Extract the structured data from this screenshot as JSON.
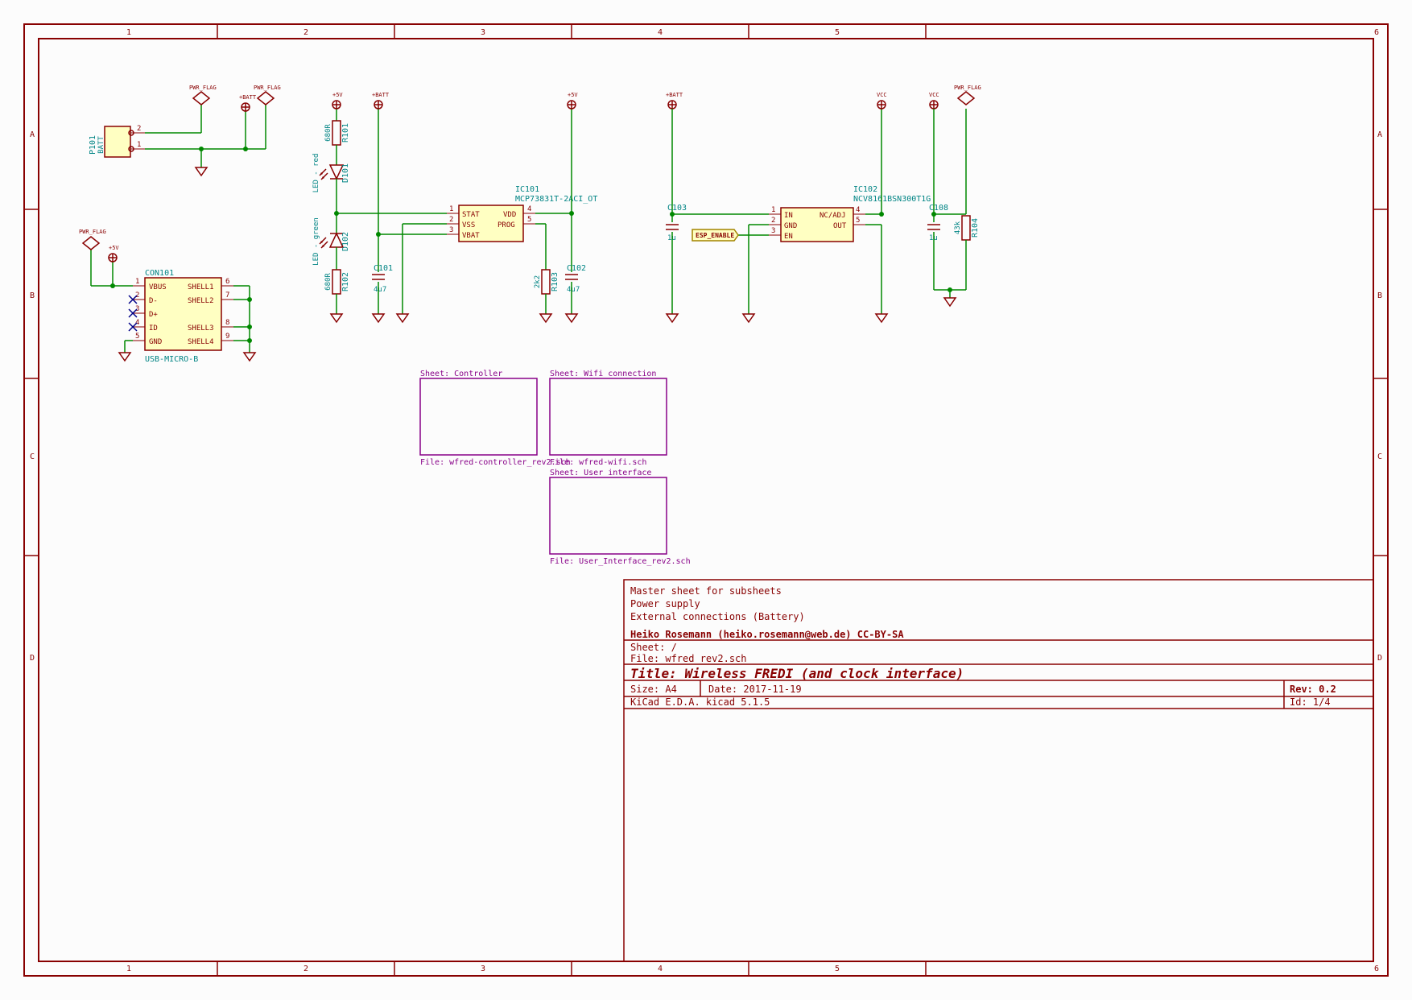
{
  "title_block": {
    "comment1": "Master sheet for subsheets",
    "comment2": "Power supply",
    "comment3": "External connections (Battery)",
    "author": "Heiko Rosemann (heiko.rosemann@web.de) CC-BY-SA",
    "sheet_label": "Sheet:",
    "sheet_path": "/",
    "file_label": "File:",
    "file_name": "wfred_rev2.sch",
    "title_label": "Title:",
    "title": "Wireless FREDI (and clock interface)",
    "size_label": "Size:",
    "size": "A4",
    "date_label": "Date:",
    "date": "2017-11-19",
    "rev_label": "Rev:",
    "rev": "0.2",
    "tool": "KiCad E.D.A.  kicad 5.1.5",
    "id_label": "Id:",
    "id": "1/4"
  },
  "power_flags": {
    "pf": "PWR_FLAG"
  },
  "nets": {
    "vbatt": "+BATT",
    "v5": "+5V",
    "vcc": "VCC"
  },
  "conn_batt": {
    "ref": "P101",
    "val": "BATT",
    "pin1": "1",
    "pin2": "2"
  },
  "conn_usb": {
    "ref": "CON101",
    "val": "USB-MICRO-B",
    "p1": "VBUS",
    "p2": "D-",
    "p3": "D+",
    "p4": "ID",
    "p5": "GND",
    "p6": "SHELL1",
    "p7": "SHELL2",
    "p8": "SHELL3",
    "p9": "SHELL4",
    "n1": "1",
    "n2": "2",
    "n3": "3",
    "n4": "4",
    "n5": "5",
    "n6": "6",
    "n7": "7",
    "n8": "8",
    "n9": "9"
  },
  "r101": {
    "ref": "R101",
    "val": "680R"
  },
  "r102": {
    "ref": "R102",
    "val": "680R"
  },
  "r103": {
    "ref": "R103",
    "val": "2k2"
  },
  "r104": {
    "ref": "R104",
    "val": "43k"
  },
  "d101": {
    "ref": "D101",
    "val": "LED - red"
  },
  "d102": {
    "ref": "D102",
    "val": "LED - green"
  },
  "c101": {
    "ref": "C101",
    "val": "4u7"
  },
  "c102": {
    "ref": "C102",
    "val": "4u7"
  },
  "c103": {
    "ref": "C103",
    "val": "1u"
  },
  "c108": {
    "ref": "C108",
    "val": "1u"
  },
  "ic101": {
    "ref": "IC101",
    "val": "MCP73831T-2ACI_OT",
    "p_stat": "STAT",
    "p_vss": "VSS",
    "p_vbat": "VBAT",
    "p_vdd": "VDD",
    "p_prog": "PROG",
    "n1": "1",
    "n2": "2",
    "n3": "3",
    "n4": "4",
    "n5": "5"
  },
  "ic102": {
    "ref": "IC102",
    "val": "NCV8161BSN300T1G",
    "p_in": "IN",
    "p_gnd": "GND",
    "p_en": "EN",
    "p_nc": "NC/ADJ",
    "p_out": "OUT",
    "n1": "1",
    "n2": "2",
    "n3": "3",
    "n4": "4",
    "n5": "5"
  },
  "esp_en": "ESP_ENABLE",
  "sheets": {
    "s1_name": "Sheet: Controller",
    "s1_file": "File: wfred-controller_rev2.sch",
    "s2_name": "Sheet: Wifi connection",
    "s2_file": "File: wfred-wifi.sch",
    "s3_name": "Sheet: User interface",
    "s3_file": "File: User_Interface_rev2.sch"
  },
  "grid": {
    "c1": "1",
    "c2": "2",
    "c3": "3",
    "c4": "4",
    "c5": "5",
    "c6": "6",
    "rA": "A",
    "rB": "B",
    "rC": "C",
    "rD": "D"
  }
}
